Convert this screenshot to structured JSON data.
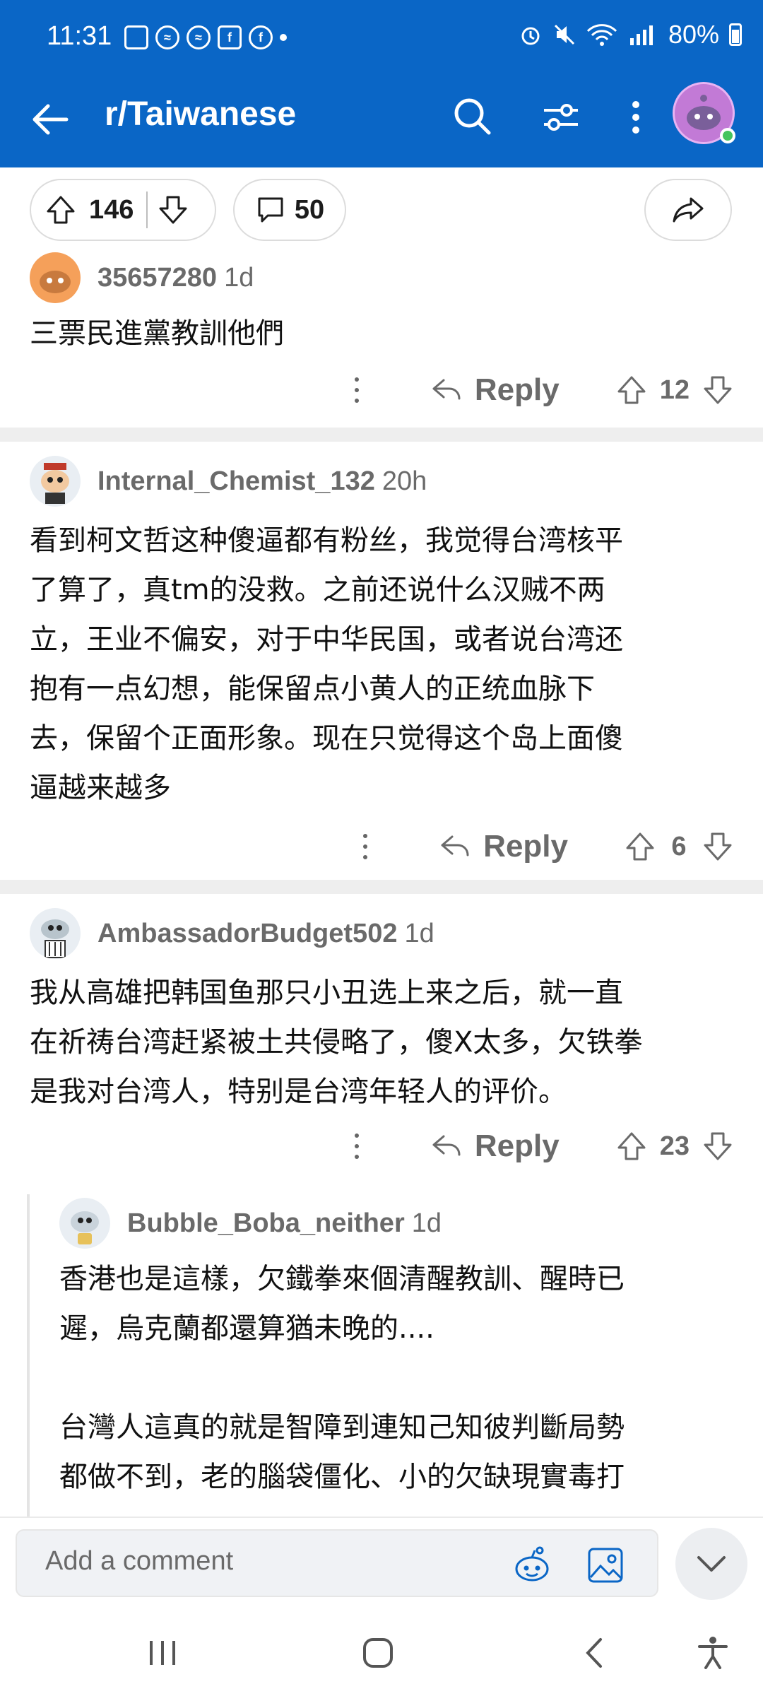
{
  "status_bar": {
    "time": "11:31",
    "battery": "80%"
  },
  "app_bar": {
    "title": "r/Taiwanese"
  },
  "post_actions": {
    "score": "146",
    "comments": "50"
  },
  "comments": [
    {
      "user": "35657280",
      "time": "1d",
      "body": "三票民進黨教訓他們",
      "reply_label": "Reply",
      "score": "12"
    },
    {
      "user": "Internal_Chemist_132",
      "time": "20h",
      "body": "看到柯文哲这种傻逼都有粉丝，我觉得台湾核平\n了算了，真tm的没救。之前还说什么汉贼不两\n立，王业不偏安，对于中华民国，或者说台湾还\n抱有一点幻想，能保留点小黄人的正统血脉下\n去，保留个正面形象。现在只觉得这个岛上面傻\n逼越来越多",
      "reply_label": "Reply",
      "score": "6"
    },
    {
      "user": "AmbassadorBudget502",
      "time": "1d",
      "body": "我从高雄把韩国鱼那只小丑选上来之后，就一直\n在祈祷台湾赶紧被土共侵略了，傻X太多，欠铁拳\n是我对台湾人，特别是台湾年轻人的评价。",
      "reply_label": "Reply",
      "score": "23"
    },
    {
      "user": "Bubble_Boba_neither",
      "time": "1d",
      "body": "香港也是這樣，欠鐵拳來個清醒教訓、醒時已\n遲，烏克蘭都還算猶未晚的....\n\n台灣人這真的就是智障到連知己知彼判斷局勢\n都做不到，老的腦袋僵化、小的欠缺現實毒打"
    }
  ],
  "comment_bar": {
    "placeholder": "Add a comment"
  },
  "colors": {
    "app_bar": "#0a66c6",
    "text_secondary": "#6a6a6a"
  }
}
